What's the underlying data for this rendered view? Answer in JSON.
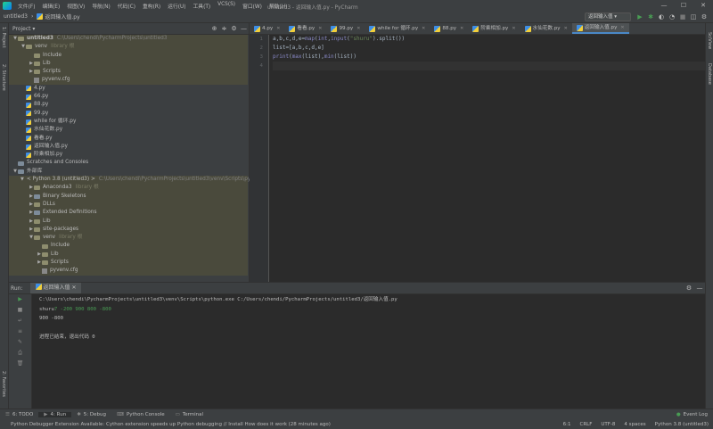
{
  "menu": [
    "文件(F)",
    "编辑(E)",
    "视图(V)",
    "导航(N)",
    "代码(C)",
    "重构(R)",
    "运行(U)",
    "工具(T)",
    "VCS(S)",
    "窗口(W)",
    "帮助(H)"
  ],
  "window_title": "untitled3 - 返回输入值.py - PyCharm",
  "breadcrumb": {
    "project": "untitled3",
    "file": "返回输入值.py"
  },
  "run_config": "返回输入值 ▾",
  "left_strip": {
    "project": "1: Project",
    "structure": "2: Structure",
    "favorites": "2: Favorites"
  },
  "right_strip": {
    "scview": "SciView",
    "database": "Database"
  },
  "project_panel": {
    "title": "Project ▾",
    "rows": [
      {
        "arrow": "▼",
        "icon": "folder",
        "label": "untitled3",
        "extra": "C:\\Users\\chendi\\PycharmProjects\\untitled3",
        "indent": 0,
        "bold": true,
        "hl": true
      },
      {
        "arrow": "▼",
        "icon": "folder",
        "label": "venv",
        "extra": "library 根",
        "indent": 1,
        "hl": true
      },
      {
        "arrow": "",
        "icon": "folder",
        "label": "Include",
        "extra": "",
        "indent": 2,
        "hl": true
      },
      {
        "arrow": "▶",
        "icon": "folder",
        "label": "Lib",
        "extra": "",
        "indent": 2,
        "hl": true
      },
      {
        "arrow": "▶",
        "icon": "folder",
        "label": "Scripts",
        "extra": "",
        "indent": 2,
        "hl": true
      },
      {
        "arrow": "",
        "icon": "cfg",
        "label": "pyvenv.cfg",
        "extra": "",
        "indent": 2,
        "hl": true
      },
      {
        "arrow": "",
        "icon": "py",
        "label": "4.py",
        "extra": "",
        "indent": 1
      },
      {
        "arrow": "",
        "icon": "py",
        "label": "66.py",
        "extra": "",
        "indent": 1
      },
      {
        "arrow": "",
        "icon": "py",
        "label": "88.py",
        "extra": "",
        "indent": 1
      },
      {
        "arrow": "",
        "icon": "py",
        "label": "99.py",
        "extra": "",
        "indent": 1
      },
      {
        "arrow": "",
        "icon": "py",
        "label": "while for 循环.py",
        "extra": "",
        "indent": 1
      },
      {
        "arrow": "",
        "icon": "py",
        "label": "水仙花数.py",
        "extra": "",
        "indent": 1
      },
      {
        "arrow": "",
        "icon": "py",
        "label": "看看.py",
        "extra": "",
        "indent": 1
      },
      {
        "arrow": "",
        "icon": "py",
        "label": "返回输入值.py",
        "extra": "",
        "indent": 1
      },
      {
        "arrow": "",
        "icon": "py",
        "label": "阶乘相加.py",
        "extra": "",
        "indent": 1
      },
      {
        "arrow": "",
        "icon": "lib",
        "label": "Scratches and Consoles",
        "extra": "",
        "indent": 0
      },
      {
        "arrow": "▼",
        "icon": "lib",
        "label": "外部库",
        "extra": "",
        "indent": 0
      },
      {
        "arrow": "▼",
        "icon": "py",
        "label": "< Python 3.8 (untitled3) >",
        "extra": "C:\\Users\\chendi\\PycharmProjects\\untitled3\\venv\\Scripts\\pytho",
        "indent": 1,
        "hl": true
      },
      {
        "arrow": "▶",
        "icon": "folder",
        "label": "Anaconda3",
        "extra": "library 根",
        "indent": 2,
        "hl": true
      },
      {
        "arrow": "▶",
        "icon": "lib",
        "label": "Binary Skeletons",
        "extra": "",
        "indent": 2,
        "hl": true
      },
      {
        "arrow": "▶",
        "icon": "folder",
        "label": "DLLs",
        "extra": "",
        "indent": 2,
        "hl": true
      },
      {
        "arrow": "▶",
        "icon": "lib",
        "label": "Extended Definitions",
        "extra": "",
        "indent": 2,
        "hl": true
      },
      {
        "arrow": "▶",
        "icon": "folder",
        "label": "Lib",
        "extra": "",
        "indent": 2,
        "hl": true
      },
      {
        "arrow": "▶",
        "icon": "folder",
        "label": "site-packages",
        "extra": "",
        "indent": 2,
        "hl": true
      },
      {
        "arrow": "▼",
        "icon": "folder",
        "label": "venv",
        "extra": "library 根",
        "indent": 2,
        "hl": true
      },
      {
        "arrow": "",
        "icon": "folder",
        "label": "Include",
        "extra": "",
        "indent": 3,
        "hl": true
      },
      {
        "arrow": "▶",
        "icon": "folder",
        "label": "Lib",
        "extra": "",
        "indent": 3,
        "hl": true
      },
      {
        "arrow": "▶",
        "icon": "folder",
        "label": "Scripts",
        "extra": "",
        "indent": 3,
        "hl": true
      },
      {
        "arrow": "",
        "icon": "cfg",
        "label": "pyvenv.cfg",
        "extra": "",
        "indent": 3,
        "hl": true
      }
    ]
  },
  "tabs": [
    {
      "label": "4.py",
      "active": false
    },
    {
      "label": "看看.py",
      "active": false
    },
    {
      "label": "99.py",
      "active": false
    },
    {
      "label": "while for 循环.py",
      "active": false
    },
    {
      "label": "88.py",
      "active": false
    },
    {
      "label": "阶乘相加.py",
      "active": false
    },
    {
      "label": "水仙花数.py",
      "active": false
    },
    {
      "label": "返回输入值.py",
      "active": true
    }
  ],
  "code_lines": [
    {
      "n": "1",
      "html": "a,b,c,d,e=<span class=\"fn\">map</span>(<span class=\"fn\">int</span>,<span class=\"fn\">input</span>(<span class=\"str\">\"shuru\"</span>).split())"
    },
    {
      "n": "2",
      "html": "list=[a,b,c,d,e]"
    },
    {
      "n": "3",
      "html": "<span class=\"fn\">print</span>(<span class=\"fn\">max</span>(list),<span class=\"fn\">min</span>(list))"
    },
    {
      "n": "4",
      "html": ""
    }
  ],
  "run_panel": {
    "label": "Run:",
    "tab": "返回输入值",
    "lines": [
      {
        "text": "C:\\Users\\chendi\\PycharmProjects\\untitled3\\venv\\Scripts\\python.exe C:/Users/chendi/PycharmProjects/untitled3/返回输入值.py",
        "input": ""
      },
      {
        "text": "shuru",
        "input": "7 -200 900 800 -800"
      },
      {
        "text": "900 -800",
        "input": ""
      },
      {
        "text": "",
        "input": ""
      },
      {
        "text": "进程已结束，退出代码 0",
        "input": ""
      }
    ]
  },
  "bottom_tabs": [
    "6: TODO",
    "4: Run",
    "5: Debug",
    "Python Console",
    "Terminal"
  ],
  "event_log": "Event Log",
  "status": {
    "message": "Python Debugger Extension Available: Cython extension speeds up Python debugging // Install   How does it work (28 minutes ago)",
    "position": "6:1",
    "line_sep": "CRLF",
    "encoding": "UTF-8",
    "indent": "4 spaces",
    "interpreter": "Python 3.8 (untitled3)"
  }
}
